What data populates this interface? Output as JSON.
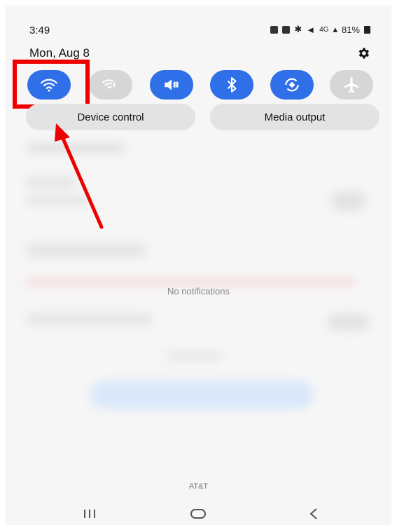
{
  "status_bar": {
    "time": "3:49",
    "battery": "81%"
  },
  "header": {
    "date": "Mon, Aug 8",
    "settings_icon": "gear-icon"
  },
  "quick_tiles": [
    {
      "name": "wifi",
      "icon": "wifi-icon",
      "state": "on",
      "color": "#2f6fe7"
    },
    {
      "name": "wifi-calling",
      "icon": "wifi-calling-icon",
      "state": "off",
      "color": "#d6d6d6"
    },
    {
      "name": "sound",
      "icon": "vibrate-icon",
      "state": "on",
      "color": "#2f6fe7"
    },
    {
      "name": "bluetooth",
      "icon": "bluetooth-icon",
      "state": "on",
      "color": "#2f6fe7"
    },
    {
      "name": "auto-rotate",
      "icon": "rotate-icon",
      "state": "on",
      "color": "#2f6fe7"
    },
    {
      "name": "airplane-mode",
      "icon": "airplane-icon",
      "state": "off",
      "color": "#d6d6d6"
    }
  ],
  "buttons": {
    "device_control": "Device control",
    "media_output": "Media output"
  },
  "notifications": {
    "empty_text": "No notifications"
  },
  "carrier": "AT&T",
  "annotation": {
    "highlight_color": "#ef0000",
    "arrow_color": "#ef0000"
  },
  "nav_bar": {
    "recent": "recent-apps-icon",
    "home": "home-icon",
    "back": "back-icon"
  }
}
